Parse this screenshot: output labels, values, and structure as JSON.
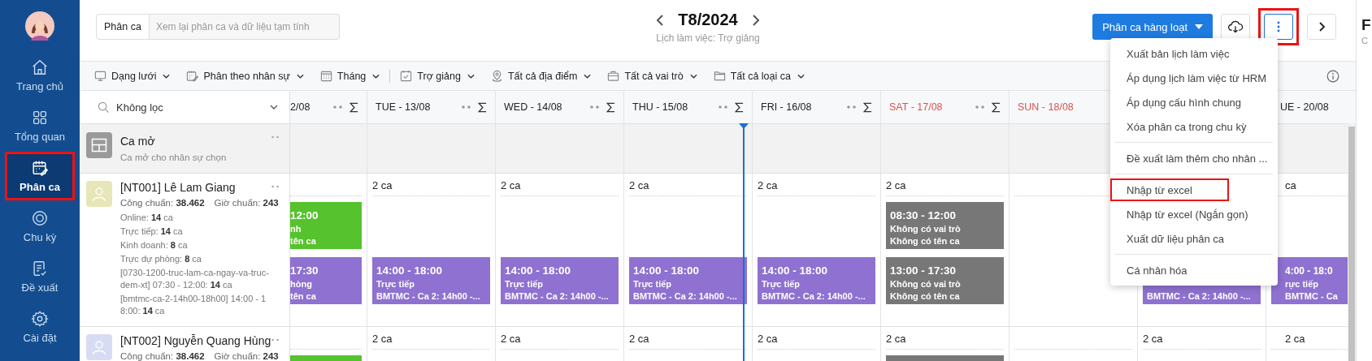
{
  "sidebar": {
    "items": [
      {
        "label": "Trang chủ",
        "kind": "home",
        "selected": false,
        "highlighted": false
      },
      {
        "label": "Tổng quan",
        "kind": "overview",
        "selected": false,
        "highlighted": false
      },
      {
        "label": "Phân ca",
        "kind": "schedule",
        "selected": true,
        "highlighted": true
      },
      {
        "label": "Chu kỳ",
        "kind": "cycle",
        "selected": false,
        "highlighted": false
      },
      {
        "label": "Đề xuất",
        "kind": "proposal",
        "selected": false,
        "highlighted": false
      },
      {
        "label": "Cài đặt",
        "kind": "settings",
        "selected": false,
        "highlighted": false
      }
    ]
  },
  "header": {
    "search_scope": "Phân ca",
    "search_placeholder": "Xem lại phân ca và dữ liệu tạm tính",
    "period": "T8/2024",
    "subtitle": "Lịch làm việc: Trợ giảng",
    "bulk_button": "Phân ca hàng loạt",
    "more_highlighted": true
  },
  "toolbar": {
    "groups": [
      [
        {
          "label": "Dạng lưới",
          "kind": "view"
        },
        {
          "label": "Phân theo nhân sự",
          "kind": "assign"
        },
        {
          "label": "Tháng",
          "kind": "month"
        }
      ],
      [
        {
          "label": "Trợ giảng",
          "kind": "schedule"
        },
        {
          "label": "Tất cả địa điểm",
          "kind": "location"
        },
        {
          "label": "Tất cả vai trò",
          "kind": "role"
        },
        {
          "label": "Tất cả loại ca",
          "kind": "folder"
        }
      ]
    ]
  },
  "grid": {
    "filter": "Không lọc",
    "days": [
      {
        "label": "2/08",
        "weekend": false,
        "tools": true
      },
      {
        "label": "TUE - 13/08",
        "weekend": false,
        "tools": true
      },
      {
        "label": "WED - 14/08",
        "weekend": false,
        "tools": true
      },
      {
        "label": "THU - 15/08",
        "weekend": false,
        "tools": true
      },
      {
        "label": "FRI - 16/08",
        "weekend": false,
        "tools": true
      },
      {
        "label": "SAT - 17/08",
        "weekend": true,
        "tools": true
      },
      {
        "label": "SUN - 18/08",
        "weekend": true,
        "tools": false
      },
      {
        "label": "UE - 20/08",
        "weekend": false,
        "tools": false
      }
    ],
    "open_row": {
      "title": "Ca mở",
      "subtitle": "Ca mở cho nhân sự chọn"
    },
    "employees": [
      {
        "name": "[NT001] Lê Lam Giang",
        "color": "#e7e6b6",
        "stats": [
          "Công chuẩn: **38.462**",
          "Giờ chuẩn: **243**"
        ],
        "details": [
          "Online: **14** ca",
          "Trực tiếp: **14** ca",
          "Kinh doanh: **8** ca",
          "Trực dự phòng: **8** ca",
          "[0730-1200-truc-lam-ca-ngay-va-truc-dem-xt] 07:30 - 12:00: **14** ca",
          "[bmtmc-ca-2-14h00-18h00] 14:00 - 18:00: **14** ca"
        ],
        "cells": [
          {
            "shifts": [
              {
                "kind": "morning",
                "color": "#56c22e",
                "time": "12:00",
                "role": "nh",
                "name": "tên ca"
              },
              {
                "kind": "afternoon",
                "color": "#8e71d0",
                "time": "17:30",
                "role": "hòng",
                "name": "tên ca"
              }
            ]
          },
          {
            "count": "2 ca",
            "shifts": [
              {
                "kind": "afternoon",
                "color": "#8e71d0",
                "time": "14:00 - 18:00",
                "role": "Trực tiếp",
                "name": "BMTMC - Ca 2: 14h00 -..."
              }
            ]
          },
          {
            "count": "2 ca",
            "shifts": [
              {
                "kind": "afternoon",
                "color": "#8e71d0",
                "time": "14:00 - 18:00",
                "role": "Trực tiếp",
                "name": "BMTMC - Ca 2: 14h00 -..."
              }
            ]
          },
          {
            "count": "2 ca",
            "shifts": [
              {
                "kind": "afternoon",
                "color": "#8e71d0",
                "time": "14:00 - 18:00",
                "role": "Trực tiếp",
                "name": "BMTMC - Ca 2: 14h00 -..."
              }
            ]
          },
          {
            "count": "2 ca",
            "shifts": [
              {
                "kind": "afternoon",
                "color": "#8e71d0",
                "time": "14:00 - 18:00",
                "role": "Trực tiếp",
                "name": "BMTMC - Ca 2: 14h00 -..."
              }
            ]
          },
          {
            "count": "2 ca",
            "shifts": [
              {
                "kind": "morning",
                "color": "#777777",
                "time": "08:30 - 12:00",
                "role": "Không có vai trò",
                "name": "Không có tên ca"
              },
              {
                "kind": "afternoon",
                "color": "#777777",
                "time": "13:00 - 17:30",
                "role": "Không có vai trò",
                "name": "Không có tên ca"
              }
            ]
          },
          {},
          {
            "shifts": [
              {
                "kind": "afternoon",
                "color": "#8e71d0",
                "name": "BMTMC - Ca 2: 14h00 -..."
              }
            ]
          },
          {
            "count": "ca",
            "shifts": [
              {
                "kind": "afternoon",
                "color": "#8e71d0",
                "time": "4:00 - 18:0",
                "role": "rực tiếp",
                "name": "BMTMC - Ca"
              }
            ]
          }
        ]
      },
      {
        "name": "[NT002] Nguyễn Quang Hùng",
        "color": "#d8dcf3",
        "stats": [
          "Công chuẩn: **38.462**",
          "Giờ chuẩn: **243**"
        ],
        "cells": [
          {
            "shifts": [
              {
                "kind": "morning",
                "color": "#56c22e"
              }
            ]
          },
          {
            "count": "2 ca"
          },
          {
            "count": "2 ca"
          },
          {
            "count": "2 ca"
          },
          {
            "count": "2 ca"
          },
          {
            "count": "2 ca",
            "shifts": [
              {
                "kind": "morning",
                "color": "#777777"
              }
            ]
          },
          {},
          {
            "count": "2 ca"
          },
          {
            "count": "2 ca"
          }
        ]
      }
    ]
  },
  "menu": {
    "groups": [
      [
        {
          "label": "Xuất bản lịch làm việc",
          "highlighted": false
        },
        {
          "label": "Áp dụng lịch làm việc từ HRM",
          "highlighted": false
        },
        {
          "label": "Áp dụng cấu hình chung",
          "highlighted": false
        },
        {
          "label": "Xóa phân ca trong chu kỳ",
          "highlighted": false
        }
      ],
      [
        {
          "label": "Đề xuất làm thêm cho nhân ...",
          "highlighted": false
        }
      ],
      [
        {
          "label": "Nhập từ excel",
          "highlighted": true
        },
        {
          "label": "Nhập từ excel (Ngắn gọn)",
          "highlighted": false
        },
        {
          "label": "Xuất dữ liệu phân ca",
          "highlighted": false
        }
      ],
      [
        {
          "label": "Cá nhân hóa",
          "highlighted": false
        }
      ]
    ]
  },
  "right_panel": {
    "title": "F",
    "subtitle": "C"
  }
}
